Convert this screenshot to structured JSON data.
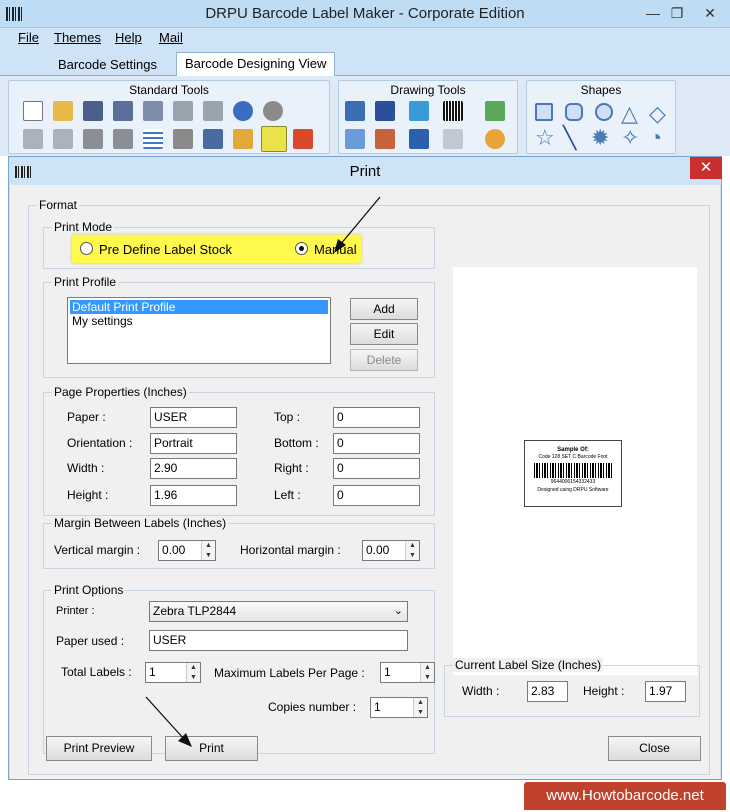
{
  "window": {
    "title": "DRPU Barcode Label Maker - Corporate Edition",
    "min_glyph": "—",
    "max_glyph": "❐",
    "close_glyph": "✕"
  },
  "menu": [
    "File",
    "Themes",
    "Help",
    "Mail"
  ],
  "tabs": {
    "barcode_settings": "Barcode Settings",
    "designing_view": "Barcode Designing View"
  },
  "ribbon": {
    "standard_tools": "Standard Tools",
    "drawing_tools": "Drawing Tools",
    "shapes": "Shapes"
  },
  "dialog": {
    "title": "Print",
    "close_glyph": "✕",
    "format_legend": "Format",
    "print_mode": {
      "legend": "Print Mode",
      "option_predefined": "Pre Define Label Stock",
      "option_manual": "Manual",
      "selected": "Manual"
    },
    "print_profile": {
      "legend": "Print Profile",
      "items": [
        "Default Print Profile",
        "My settings"
      ],
      "selected_index": 0,
      "add": "Add",
      "edit": "Edit",
      "delete": "Delete"
    },
    "page_properties": {
      "legend": "Page Properties (Inches)",
      "paper_label": "Paper :",
      "paper": "USER",
      "orientation_label": "Orientation :",
      "orientation": "Portrait",
      "width_label": "Width :",
      "width": "2.90",
      "height_label": "Height :",
      "height": "1.96",
      "top_label": "Top :",
      "top": "0",
      "bottom_label": "Bottom :",
      "bottom": "0",
      "right_label": "Right :",
      "right": "0",
      "left_label": "Left :",
      "left": "0"
    },
    "margin": {
      "legend": "Margin Between Labels (Inches)",
      "vertical_label": "Vertical margin :",
      "vertical": "0.00",
      "horizontal_label": "Horizontal margin :",
      "horizontal": "0.00"
    },
    "print_options": {
      "legend": "Print Options",
      "printer_label": "Printer :",
      "printer": "Zebra TLP2844",
      "paper_used_label": "Paper used :",
      "paper_used": "USER",
      "total_labels_label": "Total Labels :",
      "total_labels": "1",
      "max_per_page_label": "Maximum Labels Per Page :",
      "max_per_page": "1",
      "copies_label": "Copies number :",
      "copies": "1"
    },
    "preview": {
      "line1": "Sample Of:",
      "line2": "Code 128 SET C Barcode Font",
      "digits": "9644006154332433",
      "line3": "Designed using DRPU Software"
    },
    "label_size": {
      "legend": "Current Label Size (Inches)",
      "width_label": "Width :",
      "width": "2.83",
      "height_label": "Height :",
      "height": "1.97"
    },
    "buttons": {
      "print_preview": "Print Preview",
      "print": "Print",
      "close": "Close"
    }
  },
  "brand": "www.Howtobarcode.net",
  "colors": {
    "highlight": "#fff84d",
    "selection": "#3399ff",
    "close_red": "#c7302f",
    "brand_red": "#c0412c"
  }
}
